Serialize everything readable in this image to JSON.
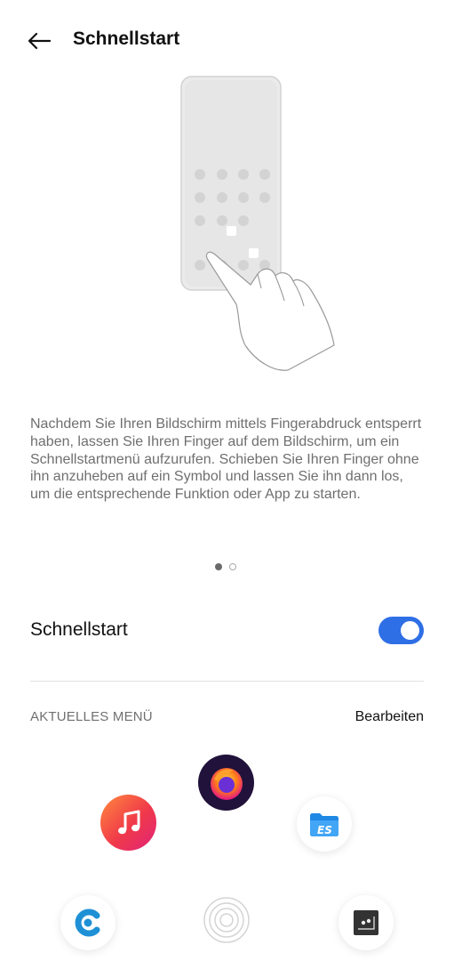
{
  "header": {
    "title": "Schnellstart"
  },
  "description": "Nachdem Sie Ihren Bildschirm mittels Fingerabdruck entsperrt haben, lassen Sie Ihren Finger auf dem Bildschirm, um ein Schnellstartmenü aufzurufen. Schieben Sie Ihren Finger ohne ihn anzuheben auf ein Symbol und lassen Sie ihn dann los, um die entsprechende Funktion oder App zu starten.",
  "pager": {
    "pages": 2,
    "current": 1
  },
  "setting": {
    "label": "Schnellstart",
    "enabled": true
  },
  "menu": {
    "section_label": "AKTUELLES MENÜ",
    "edit_label": "Bearbeiten"
  },
  "colors": {
    "accent": "#2f6fe6"
  },
  "apps": [
    {
      "icon": "firefox-icon"
    },
    {
      "icon": "music-icon"
    },
    {
      "icon": "es-file-explorer-icon"
    },
    {
      "icon": "c-app-icon"
    },
    {
      "icon": "fingerprint-icon"
    },
    {
      "icon": "here-maps-icon"
    }
  ]
}
